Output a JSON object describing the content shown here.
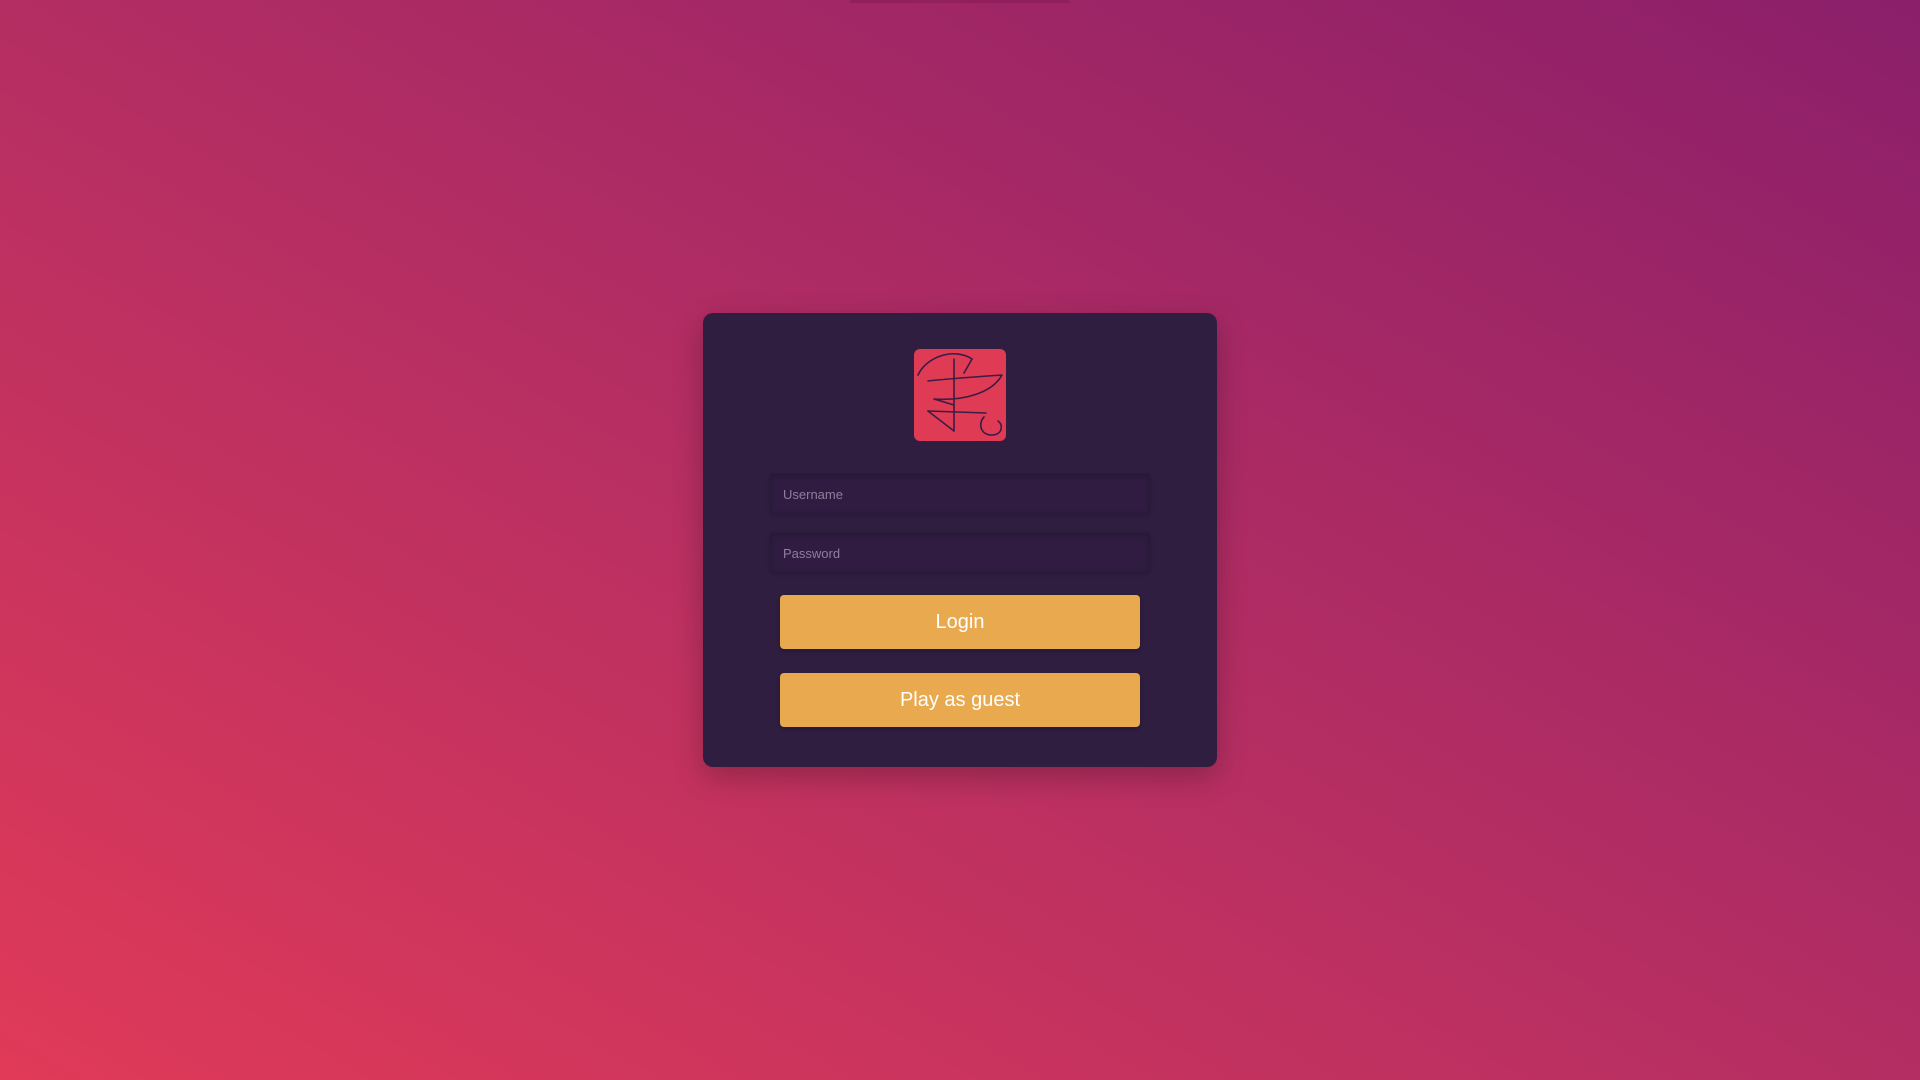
{
  "login": {
    "username_placeholder": "Username",
    "password_placeholder": "Password",
    "login_label": "Login",
    "guest_label": "Play as guest"
  },
  "logo": {
    "icon": "calligraphic-glyph-logo",
    "background_color": "#e03b55",
    "stroke_color": "#3a1c45"
  },
  "colors": {
    "card_background": "#2f1e40",
    "button_color": "#e8a94f",
    "gradient_start": "#e03a58",
    "gradient_end": "#8b1f6a"
  }
}
